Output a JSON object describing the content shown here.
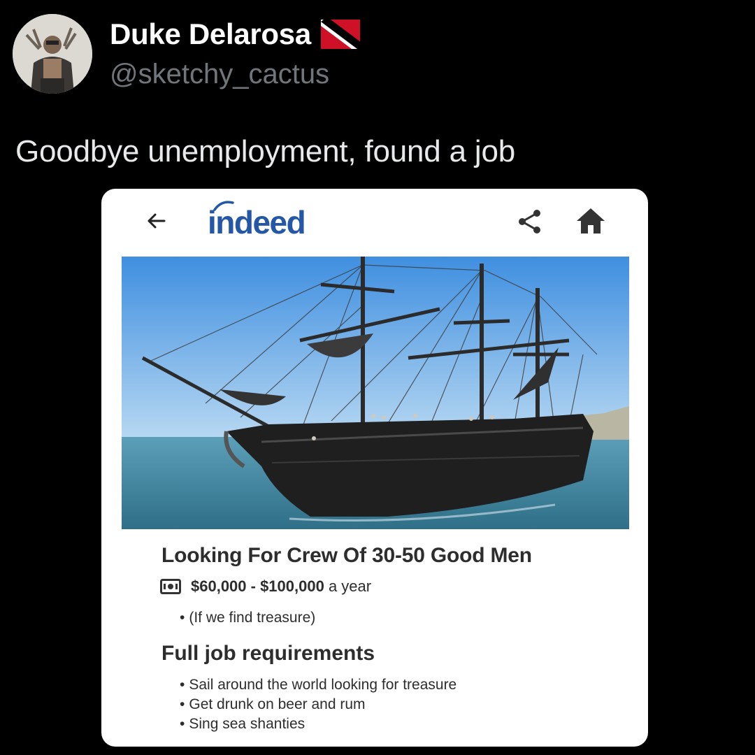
{
  "tweet": {
    "author": {
      "display_name": "Duke Delarosa",
      "handle": "@sketchy_cactus",
      "flag": "trinidad-and-tobago-flag"
    },
    "text": "Goodbye unemployment, found a job"
  },
  "job_post": {
    "app": {
      "logo_text": "indeed",
      "logo_color": "#2557a7",
      "icons": [
        "back-arrow-icon",
        "share-icon",
        "home-icon"
      ]
    },
    "image": "pirate-ship-photo",
    "title": "Looking For Crew Of 30-50 Good Men",
    "salary_range": "$60,000 - $100,000",
    "salary_period": " a year",
    "salary_note": "(If we find treasure)",
    "requirements_heading": "Full job requirements",
    "requirements": [
      "Sail around the world looking for treasure",
      "Get drunk on beer and rum",
      "Sing sea shanties"
    ]
  }
}
